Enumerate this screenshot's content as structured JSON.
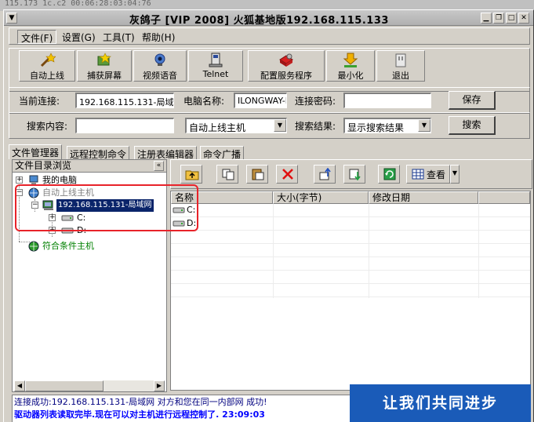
{
  "background": {
    "strip_text": "115.173 1c.c2 00:06:28:03:04:76"
  },
  "window": {
    "title": "灰鸽子 [VIP 2008] 火狐基地版192.168.115.133"
  },
  "menu": {
    "items": [
      "文件(F)",
      "设置(G)",
      "工具(T)",
      "帮助(H)"
    ]
  },
  "toolbar": {
    "buttons": [
      {
        "label": "自动上线",
        "icon": "magic-wand-icon"
      },
      {
        "label": "捕获屏幕",
        "icon": "screen-capture-icon"
      },
      {
        "label": "视频语音",
        "icon": "webcam-icon"
      },
      {
        "label": "Telnet",
        "icon": "terminal-icon"
      },
      {
        "label": "配置服务程序",
        "icon": "config-icon"
      },
      {
        "label": "最小化",
        "icon": "download-icon"
      },
      {
        "label": "退出",
        "icon": "exit-icon"
      }
    ]
  },
  "connection": {
    "current_label": "当前连接:",
    "current_value": "192.168.115.131-局域",
    "pcname_label": "电脑名称:",
    "pcname_value": "ILONGWAY-D:",
    "password_label": "连接密码:",
    "password_value": "",
    "save_label": "保存"
  },
  "search": {
    "content_label": "搜索内容:",
    "content_value": "",
    "scope_value": "自动上线主机",
    "result_label": "搜索结果:",
    "result_value": "显示搜索结果",
    "search_label": "搜索"
  },
  "tabs": [
    "文件管理器",
    "远程控制命令",
    "注册表编辑器",
    "命令广播"
  ],
  "tree": {
    "header": "文件目录浏览",
    "collapse_glyph": "«",
    "nodes": [
      {
        "label": "我的电脑"
      },
      {
        "label": "自动上线主机"
      },
      {
        "label": "192.168.115.131-局域网"
      },
      {
        "label": "C:"
      },
      {
        "label": "D:"
      },
      {
        "label": "符合条件主机"
      }
    ]
  },
  "filelist": {
    "view_label": "查看",
    "columns": [
      "名称",
      "大小(字节)",
      "修改日期"
    ],
    "rows": [
      {
        "name": "C:",
        "size": "",
        "date": ""
      },
      {
        "name": "D:",
        "size": "",
        "date": ""
      }
    ]
  },
  "status": {
    "messages": [
      "连接成功:192.168.115.131-局域网 对方和您在同一内部网 成功!",
      "驱动器列表读取完毕.现在可以对主机进行远程控制了. 23:09:03"
    ],
    "message_colors": [
      "#00007f",
      "#0000ff"
    ],
    "banner": "让我们共同进步"
  },
  "colors": {
    "highlight": "#e8232a",
    "selection": "#0a246a",
    "banner_bg": "#1a5bb8"
  }
}
